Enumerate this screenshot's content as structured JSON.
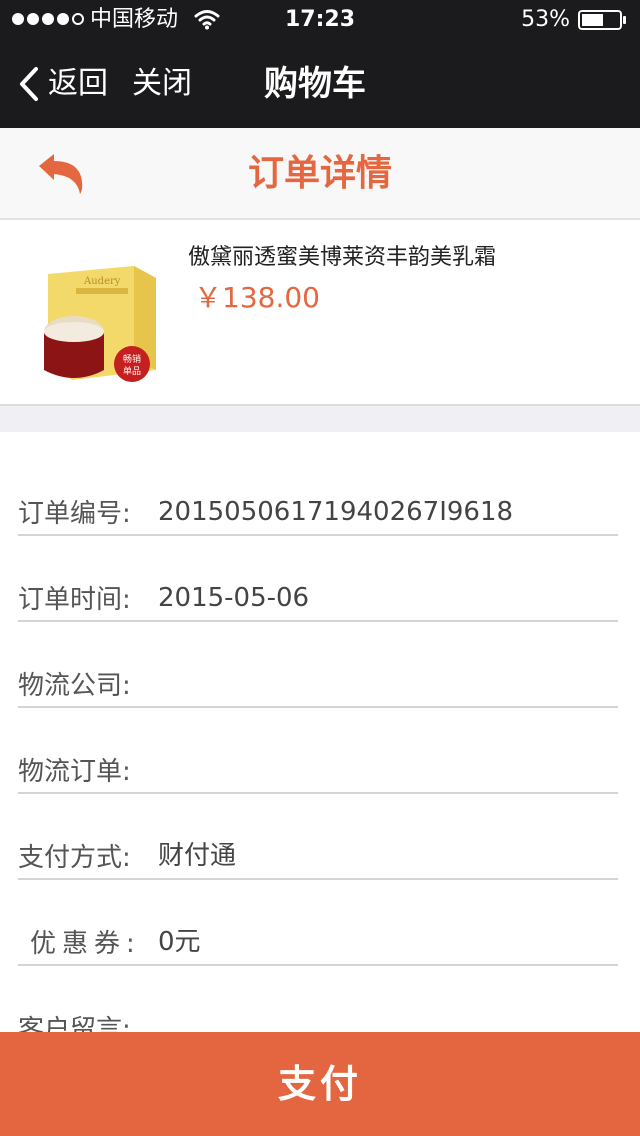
{
  "status_bar": {
    "carrier": "中国移动",
    "time": "17:23",
    "battery": "53%"
  },
  "nav": {
    "back_label": "返回",
    "close_label": "关闭",
    "title": "购物车"
  },
  "detail": {
    "title": "订单详情"
  },
  "product": {
    "name": "傲黛丽透蜜美博莱资丰韵美乳霜",
    "price": "￥138.00"
  },
  "info": [
    {
      "label": "订单编号:",
      "value": "20150506171940267I9618"
    },
    {
      "label": "订单时间:",
      "value": "2015-05-06"
    },
    {
      "label": "物流公司:",
      "value": ""
    },
    {
      "label": "物流订单:",
      "value": ""
    },
    {
      "label": "支付方式:",
      "value": "财付通"
    },
    {
      "label": "优惠券:",
      "value": "0元"
    },
    {
      "label": "客户留言:",
      "value": ""
    }
  ],
  "pay_button": {
    "label": "支付"
  },
  "colors": {
    "accent": "#e4673f",
    "topbar": "#1b1b1d",
    "pay": "#e46640"
  },
  "icons": [
    "wifi-icon",
    "battery-icon",
    "back-chevron-icon",
    "undo-arrow-icon"
  ]
}
